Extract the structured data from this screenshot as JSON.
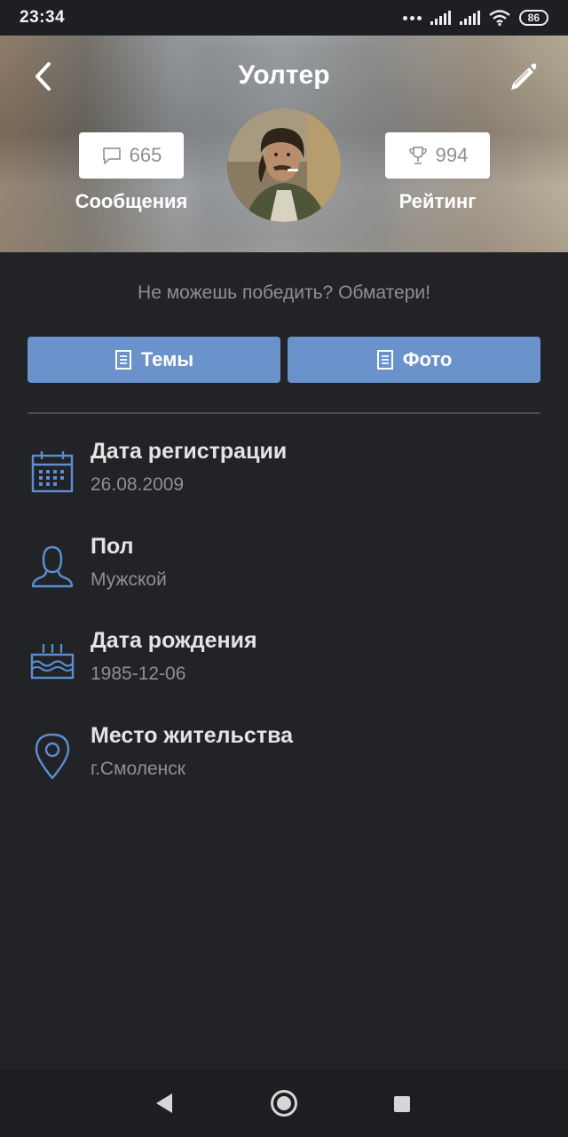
{
  "status_bar": {
    "time": "23:34",
    "battery": "86",
    "icons": [
      "more-dots-icon",
      "signal-icon",
      "signal-icon",
      "wifi-icon",
      "battery-icon"
    ]
  },
  "header": {
    "name": "Уолтер",
    "messages": {
      "count": "665",
      "label": "Сообщения",
      "icon": "chat-bubble-icon"
    },
    "rating": {
      "count": "994",
      "label": "Рейтинг",
      "icon": "trophy-icon"
    },
    "back_icon": "chevron-left-icon",
    "edit_icon": "pencil-icon"
  },
  "status_message": "Не можешь победить? Обматери!",
  "buttons": {
    "topics": {
      "label": "Темы",
      "icon": "document-icon"
    },
    "photo": {
      "label": "Фото",
      "icon": "document-icon"
    }
  },
  "info": [
    {
      "title": "Дата регистрации",
      "value": "26.08.2009",
      "icon": "calendar-icon"
    },
    {
      "title": "Пол",
      "value": "Мужской",
      "icon": "person-icon"
    },
    {
      "title": "Дата рождения",
      "value": "1985-12-06",
      "icon": "cake-icon"
    },
    {
      "title": "Место жительства",
      "value": "г.Смоленск",
      "icon": "location-pin-icon"
    }
  ],
  "colors": {
    "accent": "#6a93cc",
    "background": "#222326",
    "icon_blue": "#5b8fd1",
    "muted_text": "#8f9094"
  }
}
